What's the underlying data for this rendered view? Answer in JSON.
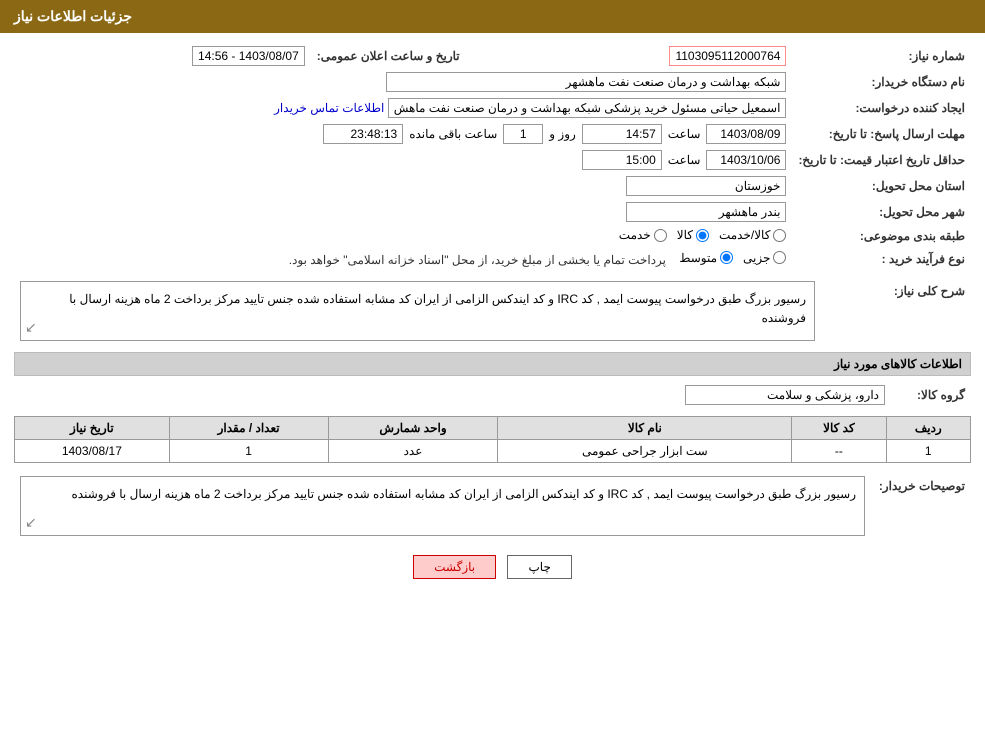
{
  "header": {
    "title": "جزئیات اطلاعات نیاز"
  },
  "fields": {
    "request_number_label": "شماره نیاز:",
    "request_number_value": "1103095112000764",
    "date_announce_label": "تاریخ و ساعت اعلان عمومی:",
    "date_announce_value": "1403/08/07 - 14:56",
    "buyer_org_label": "نام دستگاه خریدار:",
    "buyer_org_value": "شبکه بهداشت و درمان صنعت نفت ماهشهر",
    "creator_label": "ایجاد کننده درخواست:",
    "creator_value": "اسمعیل حیاتی مسئول خرید پزشکی شبکه بهداشت و درمان صنعت نفت ماهش",
    "contact_link": "اطلاعات تماس خریدار",
    "response_deadline_label": "مهلت ارسال پاسخ: تا تاریخ:",
    "response_date_value": "1403/08/09",
    "response_time_label": "ساعت",
    "response_time_value": "14:57",
    "response_day_label": "روز و",
    "response_day_value": "1",
    "response_remaining_label": "ساعت باقی مانده",
    "response_remaining_value": "23:48:13",
    "price_deadline_label": "حداقل تاریخ اعتبار قیمت: تا تاریخ:",
    "price_date_value": "1403/10/06",
    "price_time_label": "ساعت",
    "price_time_value": "15:00",
    "province_label": "استان محل تحویل:",
    "province_value": "خوزستان",
    "city_label": "شهر محل تحویل:",
    "city_value": "بندر ماهشهر",
    "category_label": "طبقه بندی موضوعی:",
    "category_goods": "کالا",
    "category_service": "خدمت",
    "category_goods_service": "کالا/خدمت",
    "process_label": "نوع فرآیند خرید :",
    "process_partial": "جزیی",
    "process_medium": "متوسط",
    "process_desc": "پرداخت تمام یا بخشی از مبلغ خرید، از محل \"اسناد خزانه اسلامی\" خواهد بود.",
    "general_description_label": "شرح کلی نیاز:",
    "general_description_text": "رسیور بزرگ طبق درخواست پیوست ایمد , کد IRC و کد ایندکس الزامی از ایران کد مشابه استفاده شده جنس تایید مرکز برداخت 2 ماه هزینه ارسال با فروشنده",
    "goods_info_label": "اطلاعات کالاهای مورد نیاز",
    "goods_group_label": "گروه کالا:",
    "goods_group_value": "دارو، پزشکی و سلامت",
    "table_headers": {
      "row_num": "ردیف",
      "goods_code": "کد کالا",
      "goods_name": "نام کالا",
      "unit": "واحد شمارش",
      "quantity": "تعداد / مقدار",
      "date": "تاریخ نیاز"
    },
    "table_rows": [
      {
        "row_num": "1",
        "goods_code": "--",
        "goods_name": "ست ابزار جراحی عمومی",
        "unit": "عدد",
        "quantity": "1",
        "date": "1403/08/17"
      }
    ],
    "buyer_notes_label": "توصیحات خریدار:",
    "buyer_notes_text": "رسیور بزرگ طبق درخواست پیوست ایمد , کد IRC و کد ایندکس الزامی از ایران کد مشابه استفاده شده جنس تایید مرکز برداخت 2 ماه هزینه ارسال با فروشنده",
    "btn_print": "چاپ",
    "btn_back": "بازگشت"
  }
}
